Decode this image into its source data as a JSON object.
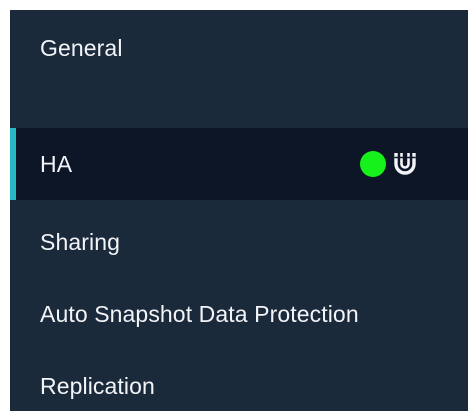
{
  "sidebar": {
    "items": [
      {
        "label": "General",
        "active": false
      },
      {
        "label": "HA",
        "active": true,
        "status_color": "#16f01b",
        "status_icon": "magnet-icon"
      },
      {
        "label": "Sharing",
        "active": false
      },
      {
        "label": "Auto Snapshot Data Protection",
        "active": false
      },
      {
        "label": "Replication",
        "active": false
      }
    ],
    "colors": {
      "background": "#1b2a3b",
      "active_background": "#0c1626",
      "accent": "#27b9c3",
      "text": "#f2f4f7"
    }
  }
}
